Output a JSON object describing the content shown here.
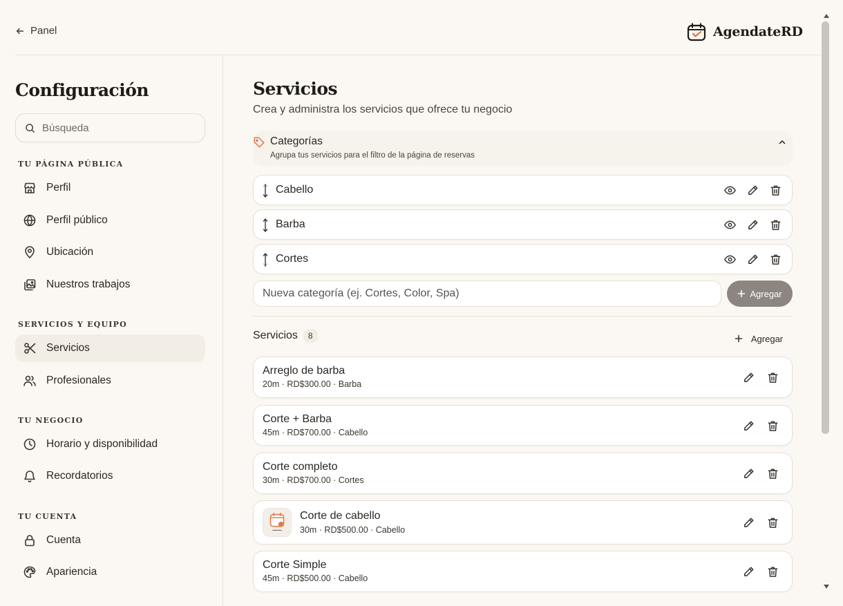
{
  "header": {
    "back_label": "Panel",
    "brand_name": "AgendateRD"
  },
  "sidebar": {
    "title": "Configuración",
    "search_placeholder": "Búsqueda",
    "sections": [
      {
        "label": "Tu página pública",
        "items": [
          {
            "label": "Perfil",
            "icon": "storefront-icon"
          },
          {
            "label": "Perfil público",
            "icon": "globe-icon"
          },
          {
            "label": "Ubicación",
            "icon": "map-pin-icon"
          },
          {
            "label": "Nuestros trabajos",
            "icon": "images-icon"
          }
        ]
      },
      {
        "label": "Servicios y equipo",
        "items": [
          {
            "label": "Servicios",
            "icon": "scissors-icon",
            "active": true
          },
          {
            "label": "Profesionales",
            "icon": "users-icon"
          }
        ]
      },
      {
        "label": "Tu negocio",
        "items": [
          {
            "label": "Horario y disponibilidad",
            "icon": "clock-icon"
          },
          {
            "label": "Recordatorios",
            "icon": "bell-icon"
          }
        ]
      },
      {
        "label": "Tu cuenta",
        "items": [
          {
            "label": "Cuenta",
            "icon": "lock-icon"
          },
          {
            "label": "Apariencia",
            "icon": "palette-icon"
          }
        ]
      }
    ]
  },
  "main": {
    "title": "Servicios",
    "subtitle": "Crea y administra los servicios que ofrece tu negocio",
    "categories": {
      "title": "Categorías",
      "description": "Agrupa tus servicios para el filtro de la página de reservas",
      "items": [
        "Cabello",
        "Barba",
        "Cortes"
      ],
      "new_placeholder": "Nueva categoría (ej. Cortes, Color, Spa)",
      "add_label": "Agregar"
    },
    "services": {
      "label": "Servicios",
      "count": "8",
      "add_label": "Agregar",
      "items": [
        {
          "name": "Arreglo de barba",
          "meta": "20m · RD$300.00 · Barba"
        },
        {
          "name": "Corte + Barba",
          "meta": "45m · RD$700.00 · Cabello"
        },
        {
          "name": "Corte completo",
          "meta": "30m · RD$700.00 · Cortes"
        },
        {
          "name": "Corte de cabello",
          "meta": "30m · RD$500.00 · Cabello",
          "has_image": true
        },
        {
          "name": "Corte Simple",
          "meta": "45m · RD$500.00 · Cabello"
        }
      ]
    }
  },
  "colors": {
    "background": "#fbf8f3",
    "brand_accent": "#e07a4a",
    "button_dark": "#8d8580"
  }
}
